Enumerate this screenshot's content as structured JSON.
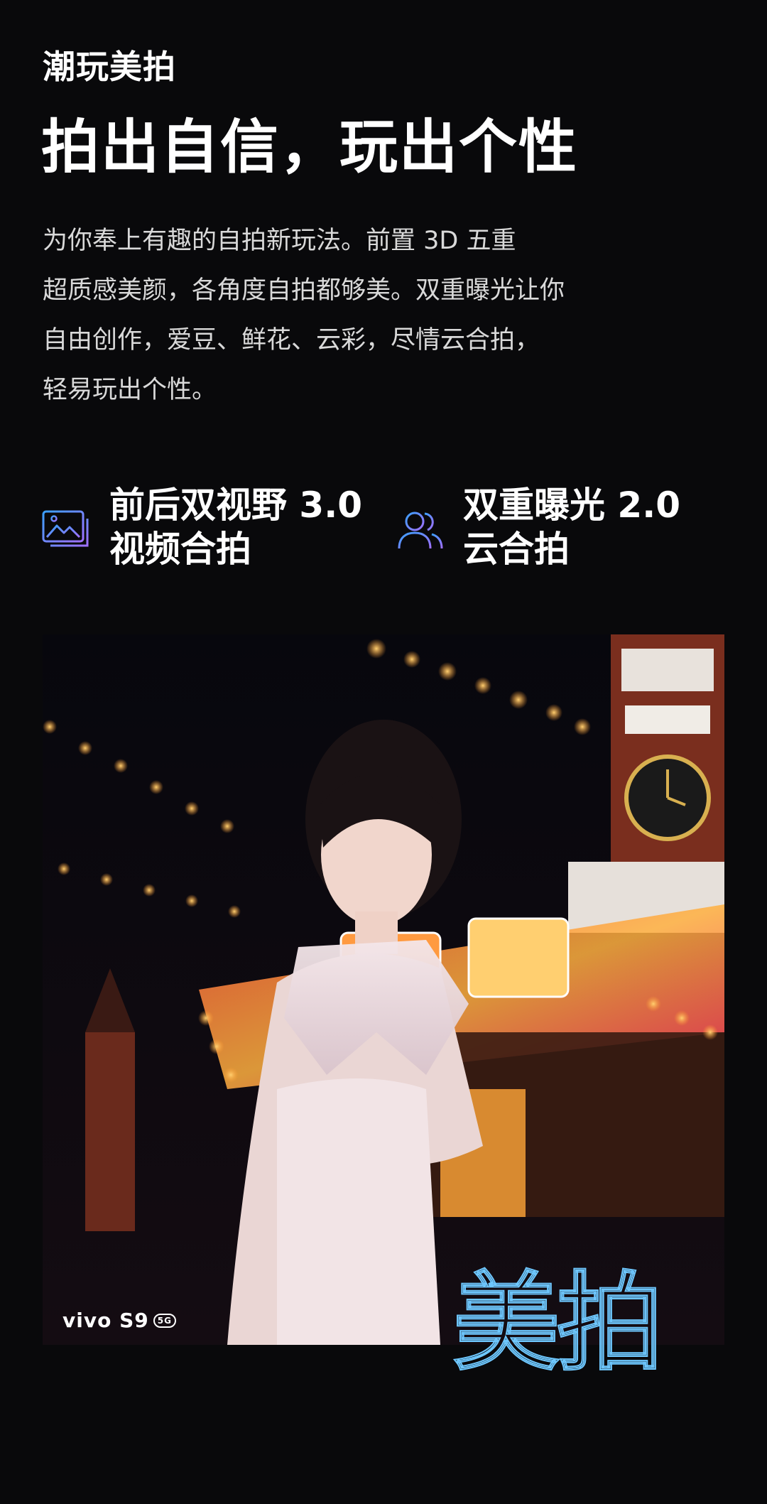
{
  "header": {
    "eyebrow": "潮玩美拍",
    "headline": "拍出自信，玩出个性"
  },
  "description": {
    "lines": [
      "为你奉上有趣的自拍新玩法。前置 3D 五重",
      "超质感美颜，各角度自拍都够美。双重曝光让你",
      "自由创作，爱豆、鲜花、云彩，尽情云合拍，",
      "轻易玩出个性。"
    ]
  },
  "features": [
    {
      "icon": "photo-gallery-icon",
      "line1": "前后双视野 3.0",
      "line2": "视频合拍"
    },
    {
      "icon": "users-icon",
      "line1": "双重曝光 2.0",
      "line2": "云合拍"
    }
  ],
  "photo": {
    "brand": "vivo S9",
    "badge": "5G",
    "overlay": "美拍"
  },
  "colors": {
    "background": "#09090b",
    "accent_blue": "#6ec8ff",
    "icon_gradient_start": "#3aa0ff",
    "icon_gradient_end": "#a070ff"
  }
}
